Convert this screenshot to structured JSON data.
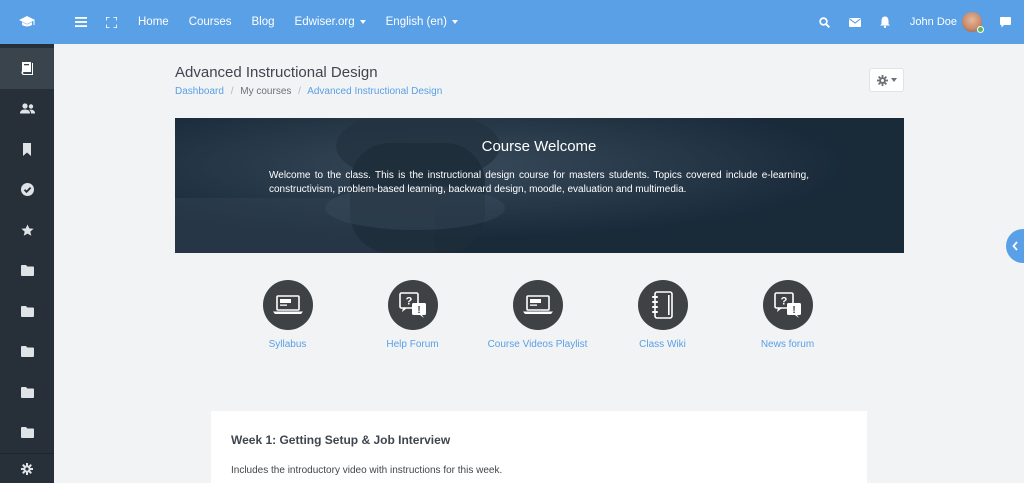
{
  "nav": {
    "links": [
      {
        "label": "Home"
      },
      {
        "label": "Courses"
      },
      {
        "label": "Blog"
      },
      {
        "label": "Edwiser.org"
      },
      {
        "label": "English (en)"
      }
    ],
    "user_name": "John Doe"
  },
  "header": {
    "title": "Advanced Instructional Design",
    "breadcrumb": [
      "Dashboard",
      "My courses",
      "Advanced Instructional Design"
    ]
  },
  "banner": {
    "title": "Course Welcome",
    "text": "Welcome to the class. This is the instructional design course for masters students. Topics covered include e-learning, constructivism, problem-based learning, backward design, moodle, evaluation and multimedia."
  },
  "activities": [
    {
      "label": "Syllabus",
      "icon": "laptop-icon"
    },
    {
      "label": "Help Forum",
      "icon": "forum-icon"
    },
    {
      "label": "Course Videos Playlist",
      "icon": "laptop-icon"
    },
    {
      "label": "Class Wiki",
      "icon": "notebook-icon"
    },
    {
      "label": "News forum",
      "icon": "forum-icon"
    }
  ],
  "section": {
    "title": "Week 1: Getting Setup & Job Interview",
    "description": "Includes the introductory video with instructions for this week."
  },
  "colors": {
    "accent": "#5aa0e6",
    "sidebar": "#273038",
    "activity_circle": "#3f4245",
    "banner": "#1b2b3a"
  }
}
